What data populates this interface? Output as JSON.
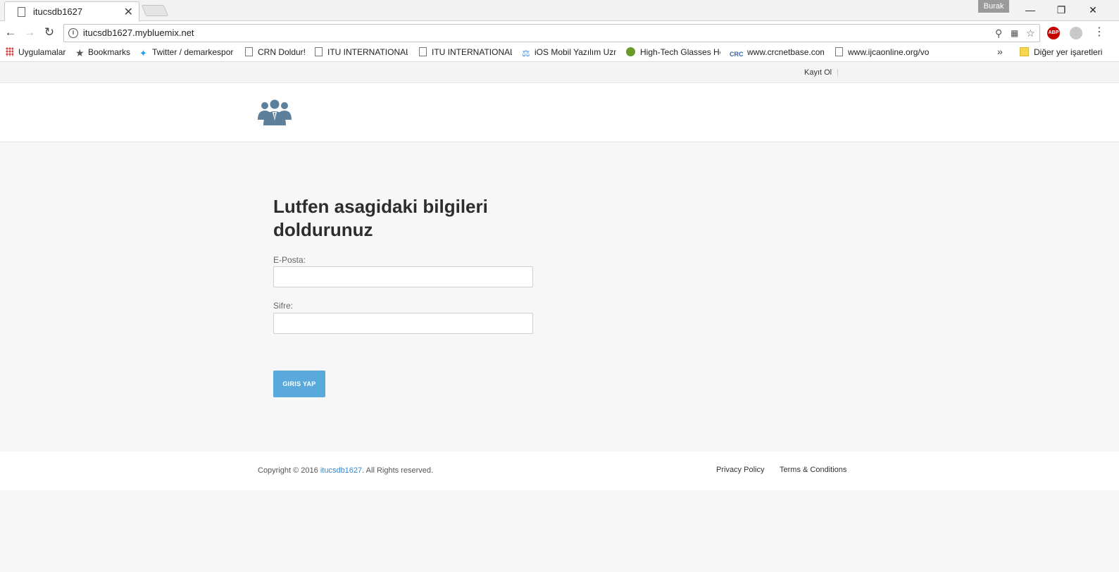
{
  "browser": {
    "tab_title": "itucsdb1627",
    "profile_name": "Burak",
    "url": "itucsdb1627.mybluemix.net",
    "extension_label": "ABP",
    "bookmarks": [
      {
        "label": "Uygulamalar",
        "icon": "apps-icon"
      },
      {
        "label": "Bookmarks",
        "icon": "star-icon"
      },
      {
        "label": "Twitter / demarkespor",
        "icon": "twitter-icon"
      },
      {
        "label": "CRN Doldur!",
        "icon": "page-icon"
      },
      {
        "label": "ITU INTERNATIONAL O",
        "icon": "page-icon"
      },
      {
        "label": "ITU INTERNATIONAL O",
        "icon": "page-icon"
      },
      {
        "label": "iOS Mobil Yazılım Uzm",
        "icon": "flask-icon"
      },
      {
        "label": "High-Tech Glasses Hel",
        "icon": "owl-icon"
      },
      {
        "label": "www.crcnetbase.com/",
        "icon": "crc-icon"
      },
      {
        "label": "www.ijcaonline.org/vo",
        "icon": "page-icon"
      }
    ],
    "other_bookmarks": "Diğer yer işaretleri",
    "more_symbol": "»"
  },
  "site": {
    "topnav": {
      "register_link": "Kayıt Ol",
      "separator": "|"
    },
    "logo_icon": "people-group-icon",
    "form": {
      "title": "Lutfen asagidaki bilgileri doldurunuz",
      "email_label": "E-Posta:",
      "email_value": "",
      "password_label": "Sifre:",
      "password_value": "",
      "submit_label": "GIRIS YAP"
    },
    "footer": {
      "copyright_prefix": "Copyright © 2016 ",
      "copyright_site": "itucsdb1627",
      "copyright_suffix": ". All Rights reserved.",
      "privacy_link": "Privacy Policy",
      "terms_link": "Terms & Conditions"
    }
  },
  "colors": {
    "accent": "#5aa9dd",
    "link": "#3a87c8",
    "logo": "#5d7f99"
  }
}
